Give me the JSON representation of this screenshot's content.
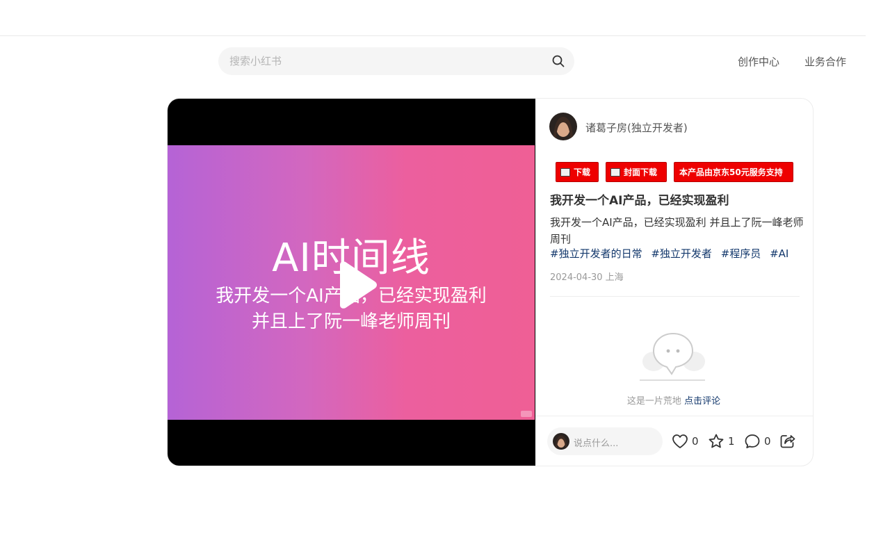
{
  "search": {
    "placeholder": "搜索小红书"
  },
  "nav": {
    "creator_center": "创作中心",
    "business": "业务合作"
  },
  "video": {
    "title": "AI时间线",
    "subtitle_line1": "我开发一个AI产品，已经实现盈利",
    "subtitle_line2": "并且上了阮一峰老师周刊"
  },
  "author": {
    "name": "诸葛子房(独立开发者)"
  },
  "tools": {
    "download": "下载",
    "cover_download": "封面下载",
    "support": "本产品由京东50元服务支持"
  },
  "note": {
    "title": "我开发一个AI产品，已经实现盈利",
    "description": "我开发一个AI产品，已经实现盈利 并且上了阮一峰老师周刊",
    "tags": [
      "#独立开发者的日常",
      "#独立开发者",
      "#程序员",
      "#AI"
    ],
    "date_location": "2024-04-30 上海"
  },
  "comments": {
    "empty_text": "这是一片荒地 ",
    "empty_link": "点击评论",
    "input_placeholder": "说点什么..."
  },
  "interactions": {
    "likes": "0",
    "collects": "1",
    "comments": "0"
  },
  "colors": {
    "accent_red": "#ee0000",
    "tag_blue": "#13386c",
    "gradient_start": "#b563d6",
    "gradient_end": "#ef5f95"
  }
}
